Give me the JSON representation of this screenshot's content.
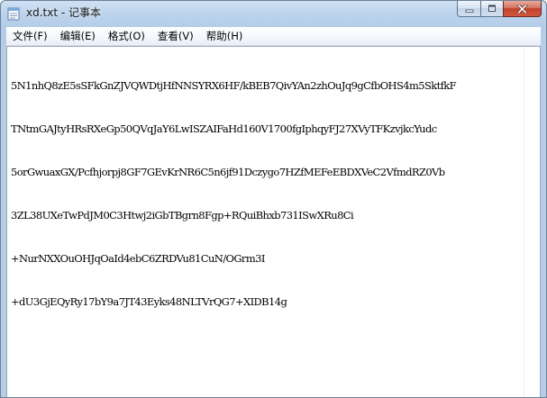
{
  "window": {
    "title": "xd.txt - 记事本",
    "title_bg_overlay": "(文)(F) 编辑(E)"
  },
  "menubar": {
    "items": [
      {
        "label": "文件(F)"
      },
      {
        "label": "编辑(E)"
      },
      {
        "label": "格式(O)"
      },
      {
        "label": "查看(V)"
      },
      {
        "label": "帮助(H)"
      }
    ]
  },
  "editor": {
    "lines": [
      "5N1nhQ8zE5sSFkGnZJVQWDtjHfNNSYRX6HF/kBEB7QivYAn2zhOuJq9gCfbOHS4m5SktfkF",
      "TNtmGAJtyHRsRXeGp50QVqJaY6LwISZAIFaHd160V1700fgIphqyFJ27XVyTFKzvjkcYudc",
      "5orGwuaxGX/Pcfhjorpj8GF7GEvKrNR6C5n6jf91Dczygo7HZfMEFeEBDXVeC2VfmdRZ0Vb",
      "3ZL38UXeTwPdJM0C3Htwj2iGbTBgrn8Fgp+RQuiBhxb731ISwXRu8Ci",
      "+NurNXXOuOHJqOaId4ebC6ZRDVu81CuN/OGrm3I",
      "+dU3GjEQyRy17bY9a7JT43Eyks48NLTVrQG7+XIDB14g"
    ]
  },
  "colors": {
    "close_button": "#c2432d",
    "titlebar": "#bcd3ec",
    "editor_bg": "#ffffff"
  },
  "icons": {
    "app": "notepad-icon",
    "minimize": "minimize-icon",
    "maximize": "maximize-icon",
    "close": "close-icon"
  }
}
